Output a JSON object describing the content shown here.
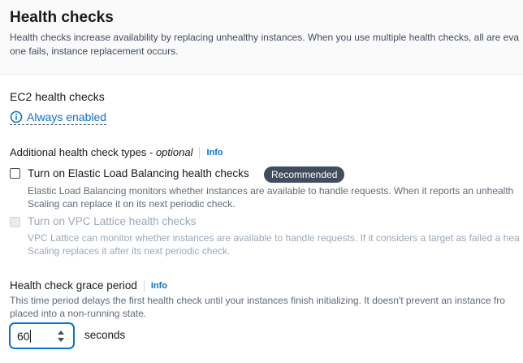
{
  "header": {
    "title": "Health checks",
    "description_line1": "Health checks increase availability by replacing unhealthy instances. When you use multiple health checks, all are eva",
    "description_line2": "one fails, instance replacement occurs."
  },
  "ec2": {
    "label": "EC2 health checks",
    "status_label": "Always enabled",
    "status_icon": "info-circle-icon"
  },
  "additional": {
    "label": "Additional health check types - ",
    "label_optional": "optional",
    "info_label": "Info"
  },
  "elb": {
    "label": "Turn on Elastic Load Balancing health checks",
    "checked": false,
    "badge": "Recommended",
    "description_line1": "Elastic Load Balancing monitors whether instances are available to handle requests. When it reports an unhealth",
    "description_line2": "Scaling can replace it on its next periodic check."
  },
  "lattice": {
    "label": "Turn on VPC Lattice health checks",
    "checked": false,
    "disabled": true,
    "description_line1": "VPC Lattice can monitor whether instances are available to handle requests. If it considers a target as failed a hea",
    "description_line2": "Scaling replaces it after its next periodic check."
  },
  "grace": {
    "label": "Health check grace period",
    "info_label": "Info",
    "description_line1": "This time period delays the first health check until your instances finish initializing. It doesn't prevent an instance fro",
    "description_line2": "placed into a non-running state.",
    "value": "60",
    "unit": "seconds"
  },
  "colors": {
    "link": "#0972d3",
    "badge_bg": "#414d5c",
    "text": "#16191f",
    "muted": "#5f6b7a"
  }
}
